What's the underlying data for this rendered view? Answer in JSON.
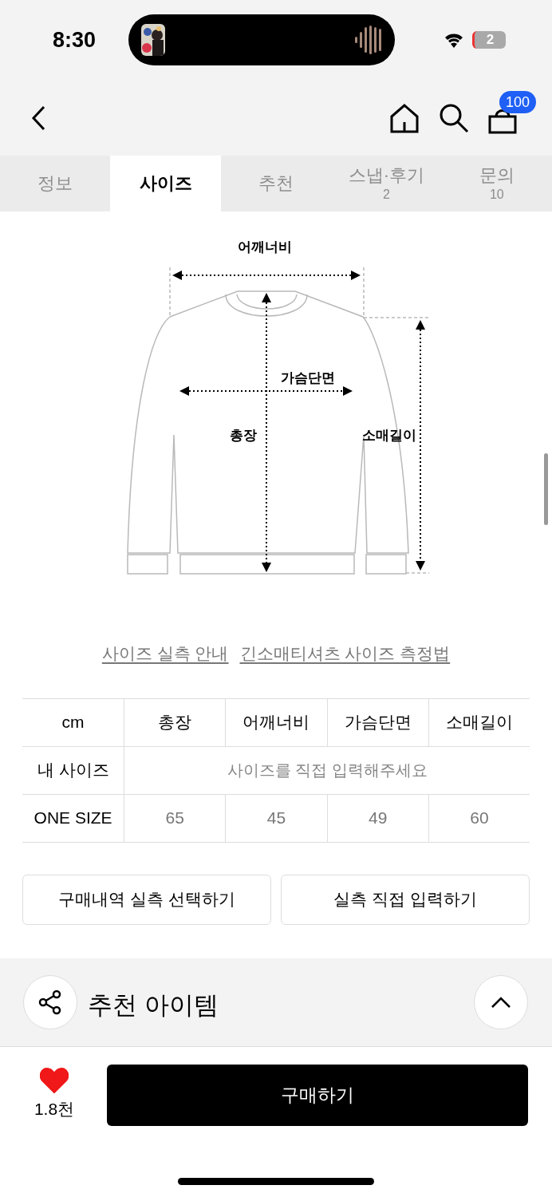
{
  "status_bar": {
    "time": "8:30",
    "battery": "2"
  },
  "header": {
    "cart_count": "100"
  },
  "tabs": [
    {
      "label": "정보",
      "selected": false
    },
    {
      "label": "사이즈",
      "selected": true
    },
    {
      "label": "추천",
      "selected": false
    },
    {
      "label": "스냅·후기",
      "count": "2",
      "selected": false
    },
    {
      "label": "문의",
      "count": "10",
      "selected": false
    }
  ],
  "diagram": {
    "labels": [
      "어깨너비",
      "가슴단면",
      "총장",
      "소매길이"
    ]
  },
  "links": [
    "사이즈 실측 안내",
    "긴소매티셔츠 사이즈 측정법"
  ],
  "size_table": {
    "columns": [
      "cm",
      "총장",
      "어깨너비",
      "가슴단면",
      "소매길이"
    ],
    "my_size": {
      "label": "내 사이즈",
      "placeholder": "사이즈를 직접 입력해주세요"
    },
    "rows": [
      {
        "cells": [
          "ONE SIZE",
          "65",
          "45",
          "49",
          "60"
        ]
      }
    ]
  },
  "actions": [
    "구매내역 실측 선택하기",
    "실측 직접 입력하기"
  ],
  "recommend": {
    "title": "추천 아이템"
  },
  "bottom_bar": {
    "liked": true,
    "likes": "1.8천",
    "buy": "구매하기"
  }
}
